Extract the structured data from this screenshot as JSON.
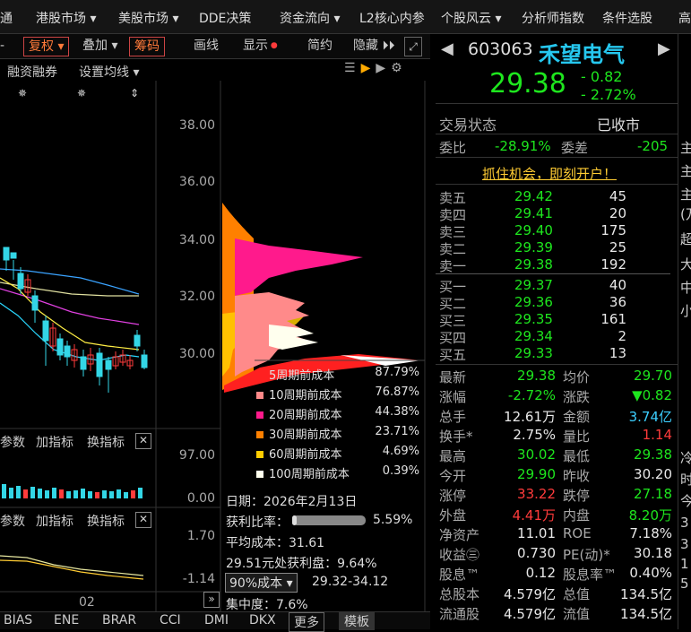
{
  "menu": [
    "通",
    "港股市场 ▾",
    "美股市场 ▾",
    "DDE决策",
    "资金流向 ▾",
    "L2核心内参",
    "个股风云 ▾",
    "分析师指数",
    "条件选股",
    "高"
  ],
  "toolbar": {
    "fuquan": "复权",
    "diejia": "叠加",
    "chouma": "筹码",
    "huaxian": "画线",
    "xianshi": "显示",
    "jianyue": "简约",
    "yincang": "隐藏"
  },
  "subbar": {
    "rongzi": "融资融券",
    "shezhi": "设置均线"
  },
  "yaxis": [
    "38.00",
    "36.00",
    "34.00",
    "32.00",
    "30.00"
  ],
  "legend": [
    {
      "label": "5周期前成本",
      "pct": "87.79%",
      "color": "#ff2020"
    },
    {
      "label": "10周期前成本",
      "pct": "76.87%",
      "color": "#ff8a8a"
    },
    {
      "label": "20周期前成本",
      "pct": "44.38%",
      "color": "#ff1a8c"
    },
    {
      "label": "30周期前成本",
      "pct": "23.71%",
      "color": "#ff8000"
    },
    {
      "label": "60周期前成本",
      "pct": "4.69%",
      "color": "#ffcc00"
    },
    {
      "label": "100周期前成本",
      "pct": "0.39%",
      "color": "#ffffee"
    }
  ],
  "ind1": {
    "canshu": "参数",
    "jia": "加指标",
    "huan": "换指标",
    "top": "97.00",
    "bot": "0.00"
  },
  "ind2": {
    "canshu": "参数",
    "jia": "加指标",
    "huan": "换指标",
    "top": "1.70",
    "bot": "-1.14"
  },
  "xlabel": "02",
  "cost": {
    "date": "日期：2026年2月13日",
    "ratio_label": "获利比率：",
    "ratio": "5.59%",
    "avg": "平均成本：31.61",
    "profit": "29.51元处获利盘：9.64%",
    "sel": "90%成本 ▾",
    "range": "29.32-34.12",
    "conc": "集中度：7.6%"
  },
  "bottomtabs": [
    "BIAS",
    "ENE",
    "BRAR",
    "CCI",
    "DMI",
    "DKX",
    "更多",
    "模板"
  ],
  "stock": {
    "code": "603063",
    "name": "禾望电气",
    "price": "29.38",
    "chg": "- 0.82",
    "chgpct": "- 2.72%"
  },
  "status": {
    "label": "交易状态",
    "value": "已收市"
  },
  "weibi": {
    "l1": "委比",
    "v1": "-28.91%",
    "l2": "委差",
    "v2": "-205"
  },
  "ad": "抓住机会，即刻开户！",
  "sells": [
    [
      "卖五",
      "29.42",
      "45"
    ],
    [
      "卖四",
      "29.41",
      "20"
    ],
    [
      "卖三",
      "29.40",
      "175"
    ],
    [
      "卖二",
      "29.39",
      "25"
    ],
    [
      "卖一",
      "29.38",
      "192"
    ]
  ],
  "buys": [
    [
      "买一",
      "29.37",
      "40"
    ],
    [
      "买二",
      "29.36",
      "36"
    ],
    [
      "买三",
      "29.35",
      "161"
    ],
    [
      "买四",
      "29.34",
      "2"
    ],
    [
      "买五",
      "29.33",
      "13"
    ]
  ],
  "stats": [
    [
      "最新",
      "29.38",
      "green",
      "均价",
      "29.70",
      "green"
    ],
    [
      "涨幅",
      "-2.72%",
      "green",
      "涨跌",
      "▼0.82",
      "green"
    ],
    [
      "总手",
      "12.61万",
      "white",
      "金额",
      "3.74亿",
      "cyan"
    ],
    [
      "换手*",
      "2.75%",
      "white",
      "量比",
      "1.14",
      "red"
    ],
    [
      "最高",
      "30.02",
      "green",
      "最低",
      "29.38",
      "green"
    ],
    [
      "今开",
      "29.90",
      "green",
      "昨收",
      "30.20",
      "white"
    ],
    [
      "涨停",
      "33.22",
      "red",
      "跌停",
      "27.18",
      "green"
    ],
    [
      "外盘",
      "4.41万",
      "red",
      "内盘",
      "8.20万",
      "green"
    ],
    [
      "净资产",
      "11.01",
      "white",
      "ROE",
      "7.18%",
      "white"
    ],
    [
      "收益㊂",
      "0.730",
      "white",
      "PE(动)*",
      "30.18",
      "white"
    ],
    [
      "股息™",
      "0.12",
      "white",
      "股息率™",
      "0.40%",
      "white"
    ],
    [
      "总股本",
      "4.579亿",
      "white",
      "总值",
      "134.5亿",
      "white"
    ],
    [
      "流通股",
      "4.579亿",
      "white",
      "流值",
      "134.5亿",
      "white"
    ]
  ],
  "edge": [
    "主",
    "主",
    "主",
    "(万",
    "超",
    "大",
    "中",
    "小",
    "冷",
    "时",
    "今",
    "3",
    "3",
    "1",
    "5"
  ],
  "colors": {
    "up": "#ff3b3b",
    "down": "#1ee61e",
    "bg": "#000000"
  }
}
